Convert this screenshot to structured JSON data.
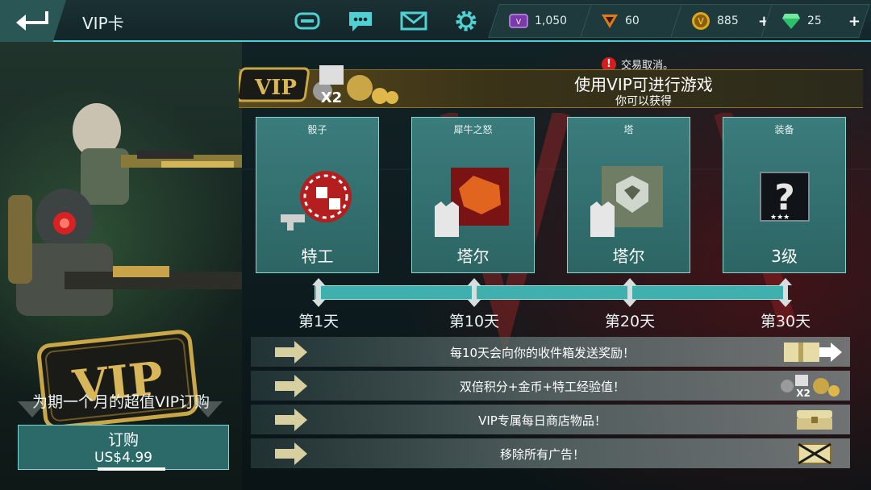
{
  "header": {
    "title": "VIP卡",
    "currencies": [
      {
        "name": "vip-points",
        "value": "1,050",
        "color": "#b267e0",
        "has_plus": false
      },
      {
        "name": "tokens",
        "value": "60",
        "color": "#e07a1a",
        "has_plus": false
      },
      {
        "name": "coins",
        "value": "885",
        "color": "#e0a71a",
        "has_plus": true
      },
      {
        "name": "gems",
        "value": "25",
        "color": "#2fc06a",
        "has_plus": true
      }
    ]
  },
  "notification": {
    "icon": "!",
    "text": "交易取消。"
  },
  "promo": {
    "tagline": "为期一个月的超值VIP订购",
    "buy_label": "订购",
    "price": "US$4.99",
    "logo_text": "VIP"
  },
  "banner": {
    "title": "使用VIP可进行游戏",
    "subtitle": "你可以获得",
    "badge_text": "VIP",
    "multiplier": "X2"
  },
  "rewards": [
    {
      "name": "骰子",
      "label": "特工",
      "icon": "dice-chip-icon"
    },
    {
      "name": "犀牛之怒",
      "label": "塔尔",
      "icon": "rhino-jersey-icon"
    },
    {
      "name": "塔",
      "label": "塔尔",
      "icon": "tower-jersey-icon"
    },
    {
      "name": "装备",
      "label": "3级",
      "icon": "mystery-gear-icon"
    }
  ],
  "timeline": {
    "days": [
      "第1天",
      "第10天",
      "第20天",
      "第30天"
    ]
  },
  "perks": [
    {
      "text": "每10天会向你的收件箱发送奖励！",
      "icon": "gift-mail-icon"
    },
    {
      "text": "双倍积分+金币+特工经验值！",
      "icon": "double-rewards-icon"
    },
    {
      "text": "VIP专属每日商店物品！",
      "icon": "chest-icon"
    },
    {
      "text": "移除所有广告！",
      "icon": "no-ads-icon"
    }
  ],
  "colors": {
    "accent": "#4fd0d2",
    "card": "#2f6c6b",
    "gold": "#c9a646",
    "alert": "#d61d1d"
  }
}
